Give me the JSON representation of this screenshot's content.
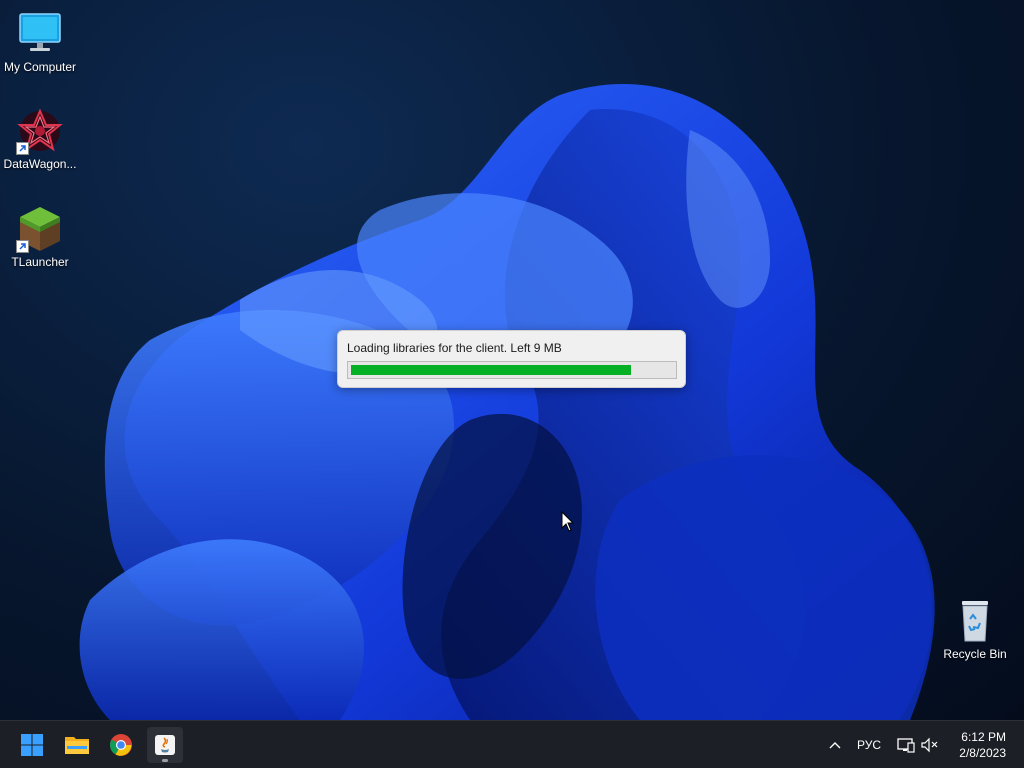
{
  "desktop": {
    "icons": [
      {
        "label": "My Computer"
      },
      {
        "label": "DataWagon..."
      },
      {
        "label": "TLauncher"
      },
      {
        "label": "Recycle Bin"
      }
    ]
  },
  "loader": {
    "message": "Loading libraries for the client. Left 9 MB",
    "progress_percent": 87,
    "fill_color": "#06b025"
  },
  "taskbar": {
    "apps": [
      {
        "icon": "windows-start-icon"
      },
      {
        "icon": "file-explorer-icon"
      },
      {
        "icon": "chrome-icon"
      },
      {
        "icon": "java-icon",
        "active": true
      }
    ],
    "tray": {
      "language": "РУС",
      "time": "6:12 PM",
      "date": "2/8/2023"
    }
  }
}
